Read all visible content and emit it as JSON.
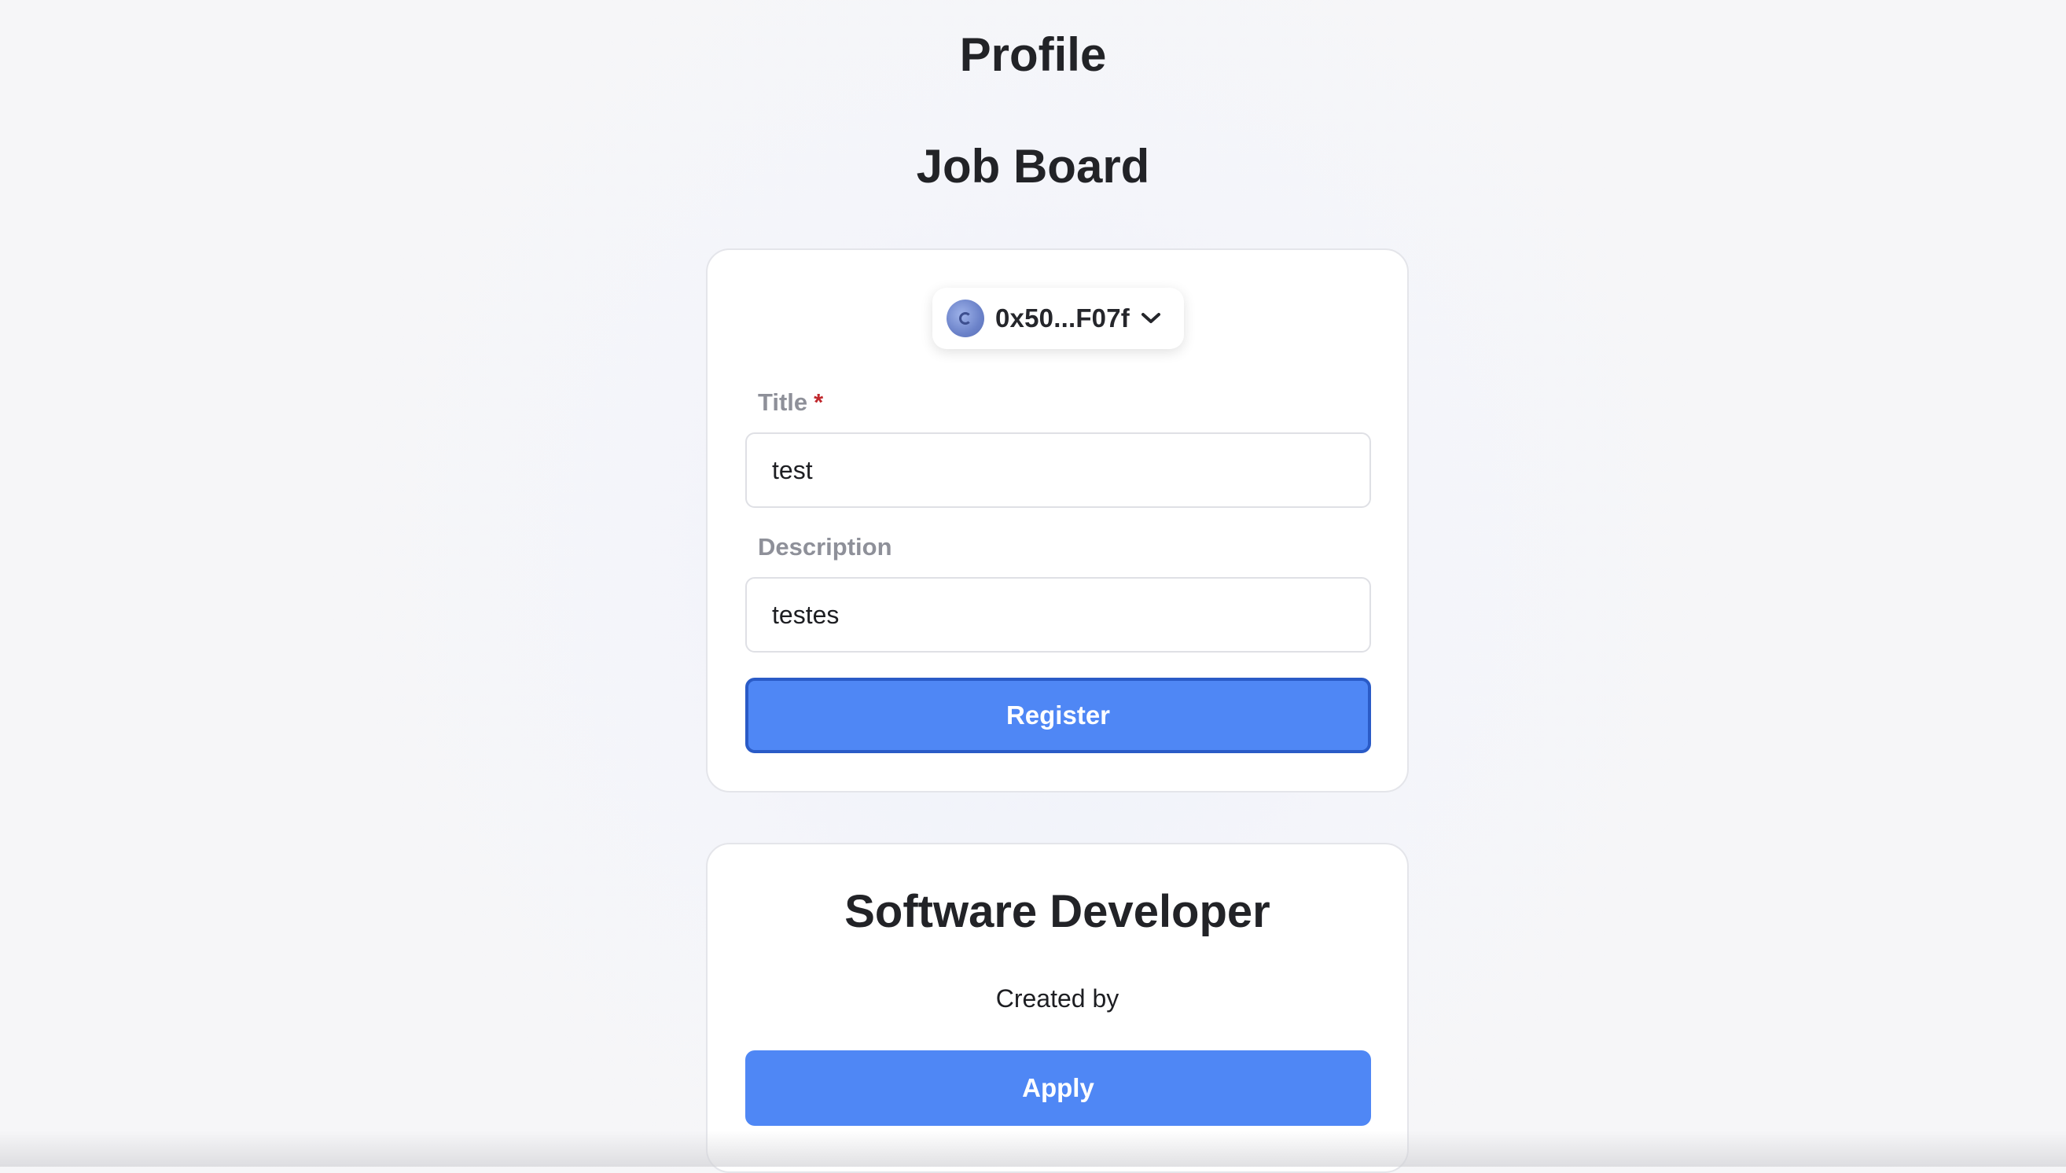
{
  "page": {
    "profile_title": "Profile",
    "board_title": "Job Board"
  },
  "wallet": {
    "address": "0x50...F07f",
    "avatar_icon": "wallet-avatar-icon",
    "chevron_icon": "chevron-down-icon"
  },
  "form": {
    "title_label": "Title",
    "required_mark": "*",
    "title_value": "test",
    "description_label": "Description",
    "description_value": "testes",
    "submit_label": "Register"
  },
  "job": {
    "title": "Software Developer",
    "created_by": "Created by",
    "apply_label": "Apply"
  },
  "colors": {
    "primary": "#4f87f5",
    "primary_border": "#2a5bc7",
    "required": "#c0282d",
    "label": "#8e9099"
  }
}
